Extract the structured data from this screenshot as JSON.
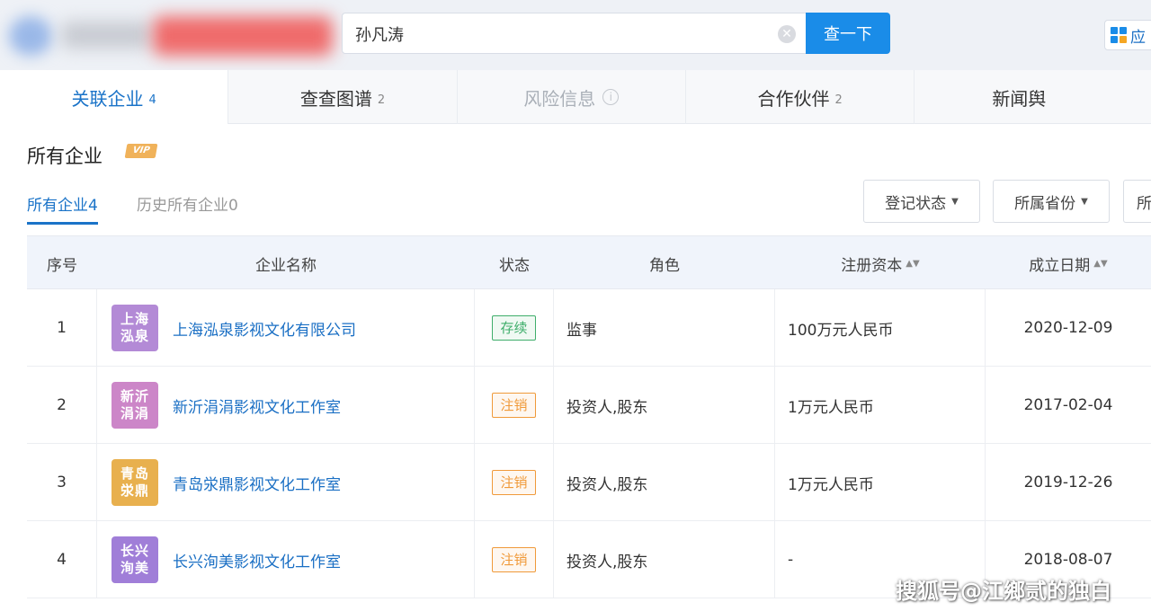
{
  "search": {
    "query": "孙凡涛",
    "button_label": "查一下"
  },
  "header": {
    "app_label": "应"
  },
  "tabs": [
    {
      "label": "关联企业",
      "count": "4"
    },
    {
      "label": "查查图谱",
      "count": "2"
    },
    {
      "label": "风险信息",
      "count": "i"
    },
    {
      "label": "合作伙伴",
      "count": "2"
    },
    {
      "label": "新闻舆",
      "count": ""
    }
  ],
  "section": {
    "title": "所有企业",
    "vip": "VIP"
  },
  "subtabs": {
    "active": "所有企业",
    "active_count": "4",
    "inactive": "历史所有企业",
    "inactive_count": "0"
  },
  "filters": [
    {
      "label": "登记状态"
    },
    {
      "label": "所属省份"
    },
    {
      "label": "所"
    }
  ],
  "table": {
    "headers": {
      "no": "序号",
      "name": "企业名称",
      "status": "状态",
      "role": "角色",
      "capital": "注册资本",
      "date": "成立日期"
    },
    "rows": [
      {
        "no": "1",
        "logo_line1": "上海",
        "logo_line2": "泓泉",
        "logo_color": "#b38ad6",
        "name": "上海泓泉影视文化有限公司",
        "status": "存续",
        "status_color": "#3fae6b",
        "role": "监事",
        "capital": "100万元人民币",
        "date": "2020-12-09"
      },
      {
        "no": "2",
        "logo_line1": "新沂",
        "logo_line2": "涓涓",
        "logo_color": "#cc86c8",
        "name": "新沂涓涓影视文化工作室",
        "status": "注销",
        "status_color": "#f09a3a",
        "role": "投资人,股东",
        "capital": "1万元人民币",
        "date": "2017-02-04"
      },
      {
        "no": "3",
        "logo_line1": "青岛",
        "logo_line2": "泶鼎",
        "logo_color": "#e8b04e",
        "name": "青岛泶鼎影视文化工作室",
        "status": "注销",
        "status_color": "#f09a3a",
        "role": "投资人,股东",
        "capital": "1万元人民币",
        "date": "2019-12-26"
      },
      {
        "no": "4",
        "logo_line1": "长兴",
        "logo_line2": "洵美",
        "logo_color": "#a07ed8",
        "name": "长兴洵美影视文化工作室",
        "status": "注销",
        "status_color": "#f09a3a",
        "role": "投资人,股东",
        "capital": "-",
        "date": "2018-08-07"
      }
    ]
  },
  "watermark": "搜狐号@江鄉贰的独白",
  "colors": {
    "accent": "#1a73c8",
    "search_button": "#1a8ce8"
  }
}
